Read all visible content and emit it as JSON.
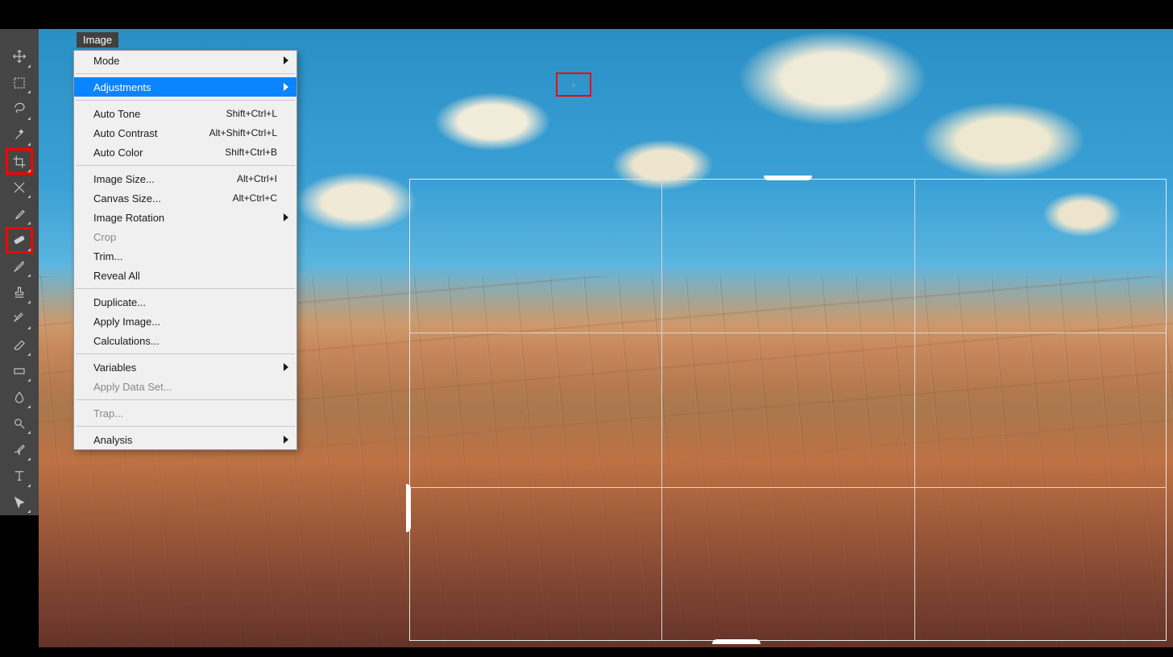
{
  "menu_label": "Image",
  "tools": [
    {
      "name": "move",
      "selected": false
    },
    {
      "name": "marquee",
      "selected": false
    },
    {
      "name": "lasso",
      "selected": false
    },
    {
      "name": "wand",
      "selected": false
    },
    {
      "name": "crop",
      "selected": true
    },
    {
      "name": "slice",
      "selected": false
    },
    {
      "name": "eyedropper",
      "selected": false
    },
    {
      "name": "healing",
      "selected": true
    },
    {
      "name": "brush",
      "selected": false
    },
    {
      "name": "stamp",
      "selected": false
    },
    {
      "name": "history-brush",
      "selected": false
    },
    {
      "name": "eraser",
      "selected": false
    },
    {
      "name": "gradient",
      "selected": false
    },
    {
      "name": "blur",
      "selected": false
    },
    {
      "name": "dodge",
      "selected": false
    },
    {
      "name": "pen",
      "selected": false
    },
    {
      "name": "type",
      "selected": false
    },
    {
      "name": "path-select",
      "selected": false
    }
  ],
  "menu": {
    "items": [
      {
        "label": "Mode",
        "submenu": true,
        "type": "sub"
      },
      {
        "type": "sep"
      },
      {
        "label": "Adjustments",
        "submenu": true,
        "type": "sub",
        "hover": true
      },
      {
        "type": "sep"
      },
      {
        "label": "Auto Tone",
        "shortcut": "Shift+Ctrl+L",
        "type": "cmd"
      },
      {
        "label": "Auto Contrast",
        "shortcut": "Alt+Shift+Ctrl+L",
        "type": "cmd"
      },
      {
        "label": "Auto Color",
        "shortcut": "Shift+Ctrl+B",
        "type": "cmd"
      },
      {
        "type": "sep"
      },
      {
        "label": "Image Size...",
        "shortcut": "Alt+Ctrl+I",
        "type": "cmd"
      },
      {
        "label": "Canvas Size...",
        "shortcut": "Alt+Ctrl+C",
        "type": "cmd"
      },
      {
        "label": "Image Rotation",
        "submenu": true,
        "type": "sub"
      },
      {
        "label": "Crop",
        "type": "cmd",
        "disabled": true
      },
      {
        "label": "Trim...",
        "type": "cmd"
      },
      {
        "label": "Reveal All",
        "type": "cmd"
      },
      {
        "type": "sep"
      },
      {
        "label": "Duplicate...",
        "type": "cmd"
      },
      {
        "label": "Apply Image...",
        "type": "cmd"
      },
      {
        "label": "Calculations...",
        "type": "cmd"
      },
      {
        "type": "sep"
      },
      {
        "label": "Variables",
        "submenu": true,
        "type": "sub"
      },
      {
        "label": "Apply Data Set...",
        "type": "cmd",
        "disabled": true
      },
      {
        "type": "sep"
      },
      {
        "label": "Trap...",
        "type": "cmd",
        "disabled": true
      },
      {
        "type": "sep"
      },
      {
        "label": "Analysis",
        "submenu": true,
        "type": "sub"
      }
    ]
  },
  "red_marker": "+"
}
